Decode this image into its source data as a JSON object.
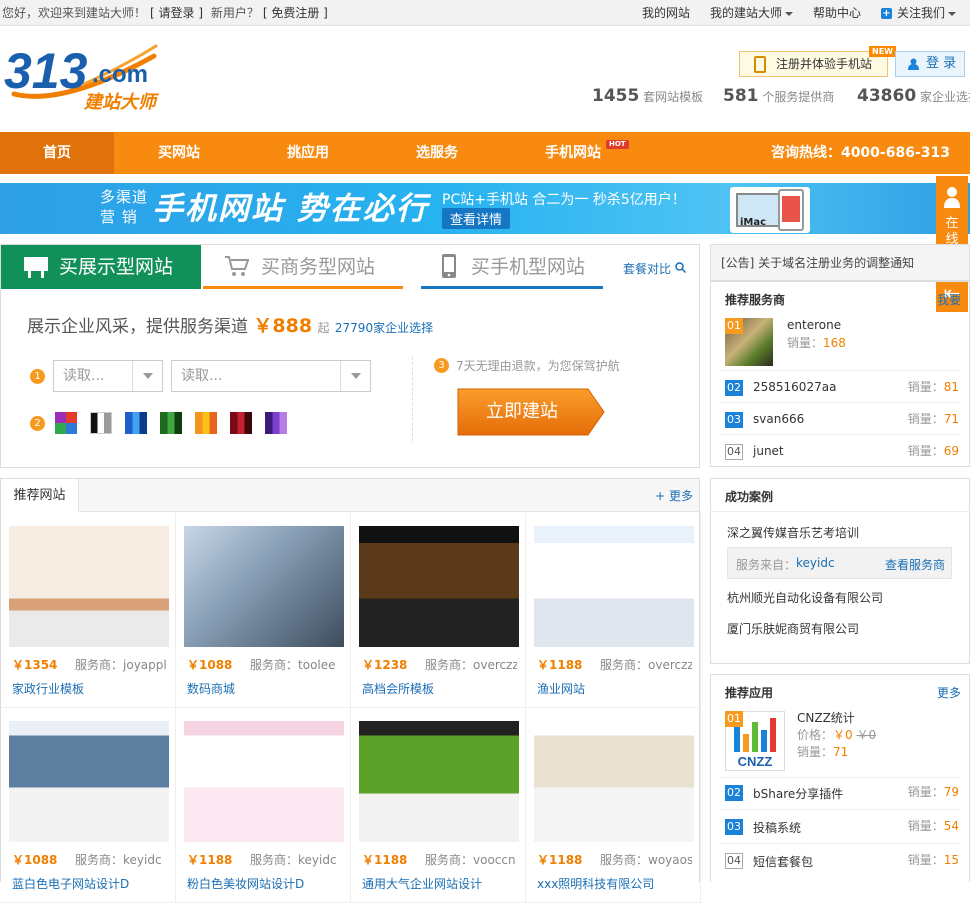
{
  "topbar": {
    "greeting": "您好，欢迎来到建站大师！",
    "login": "[ 请登录 ]",
    "new_user": "新用户？",
    "register": "[ 免费注册 ]",
    "my_sites": "我的网站",
    "my_master": "我的建站大师",
    "help": "帮助中心",
    "follow": "关注我们"
  },
  "header": {
    "logo_num": "313",
    "logo_com": ".com",
    "logo_cn": "建站大师",
    "register_mobile": "注册并体验手机站",
    "new_badge": "NEW",
    "login_btn": "登 录",
    "stats": [
      {
        "num": "1455",
        "label": "套网站模板"
      },
      {
        "num": "581",
        "label": "个服务提供商"
      },
      {
        "num": "43860",
        "label": "家企业选择"
      }
    ]
  },
  "nav": {
    "items": [
      "首页",
      "买网站",
      "挑应用",
      "选服务",
      "手机网站"
    ],
    "hot": "HOT",
    "hotline": "咨询热线：4000-686-313"
  },
  "banner": {
    "line1": "多渠道",
    "line2": "营 销",
    "main": "手机网站  势在必行",
    "sub": "PC站+手机站 合二为一   秒杀5亿用户！",
    "button": "查看详情",
    "device": "iMac"
  },
  "sidetab": {
    "label": "在线客服",
    "arrow": "⇤"
  },
  "tabs": {
    "t1": "买展示型网站",
    "t2": "买商务型网站",
    "t3": "买手机型网站",
    "compare": "套餐对比"
  },
  "buy": {
    "slogan_pre": "展示企业风采，提供服务渠道",
    "price": "￥888",
    "price_suffix": "起",
    "companies": "27790家企业选择",
    "select1": "读取...",
    "select2": "读取...",
    "refund": "7天无理由退款，为您保驾护航",
    "build": "立即建站",
    "step1": "1",
    "step2": "2",
    "step3": "3"
  },
  "swatch_colors": [
    [
      "#e53b2c",
      "#2a7ad6",
      "#31a84b",
      "#9b2db9"
    ],
    [
      "#111111",
      "#ffffff",
      "#999999"
    ],
    [
      "#1f5fc9",
      "#42a0f5",
      "#0a3c8c"
    ],
    [
      "#1e6b1e",
      "#3fa73f",
      "#0f3f0f"
    ],
    [
      "#f7941d",
      "#f9c21a",
      "#e8641b"
    ],
    [
      "#7a0a16",
      "#c3212f",
      "#40050b"
    ],
    [
      "#3b1a7a",
      "#7a3fcf",
      "#b57ee6"
    ]
  ],
  "rec": {
    "title": "推荐网站",
    "more": "+ 更多",
    "provider_label": "服务商：",
    "cards": [
      {
        "price": "￥1354",
        "provider": "joyapple",
        "name": "家政行业模板"
      },
      {
        "price": "￥1088",
        "provider": "toolee",
        "name": "数码商城"
      },
      {
        "price": "￥1238",
        "provider": "overczzz",
        "name": "高档会所模板"
      },
      {
        "price": "￥1188",
        "provider": "overczzz",
        "name": "渔业网站"
      },
      {
        "price": "￥1088",
        "provider": "keyidc",
        "name": "蓝白色电子网站设计D"
      },
      {
        "price": "￥1188",
        "provider": "keyidc",
        "name": "粉白色美妆网站设计D"
      },
      {
        "price": "￥1188",
        "provider": "vooccn",
        "name": "通用大气企业网站设计"
      },
      {
        "price": "￥1188",
        "provider": "woyaos",
        "name": "xxx照明科技有限公司"
      }
    ]
  },
  "notice": "[公告] 关于域名注册业务的调整通知",
  "providers": {
    "title": "推荐服务商",
    "more": "我要",
    "sales_label": "销量：",
    "items": [
      {
        "rank": "01",
        "name": "enterone",
        "sales": "168"
      },
      {
        "rank": "02",
        "name": "258516027aa",
        "sales": "81"
      },
      {
        "rank": "03",
        "name": "svan666",
        "sales": "71"
      },
      {
        "rank": "04",
        "name": "junet",
        "sales": "69"
      }
    ]
  },
  "cases": {
    "title": "成功案例",
    "items": [
      "深之翼传媒音乐艺考培训",
      "杭州顺光自动化设备有限公司",
      "厦门乐肤妮商贸有限公司"
    ],
    "from_label": "服务来自：",
    "from_name": "keyidc",
    "view": "查看服务商"
  },
  "apps": {
    "title": "推荐应用",
    "more": "更多",
    "top": {
      "rank": "01",
      "name": "CNZZ统计",
      "price_label": "价格：",
      "price": "￥0",
      "old_price": "￥0",
      "sales_label": "销量：",
      "sales": "71",
      "logo": "CNZZ"
    },
    "items": [
      {
        "rank": "02",
        "name": "bShare分享插件",
        "sales": "79"
      },
      {
        "rank": "03",
        "name": "投稿系统",
        "sales": "54"
      },
      {
        "rank": "04",
        "name": "短信套餐包",
        "sales": "15"
      }
    ]
  }
}
